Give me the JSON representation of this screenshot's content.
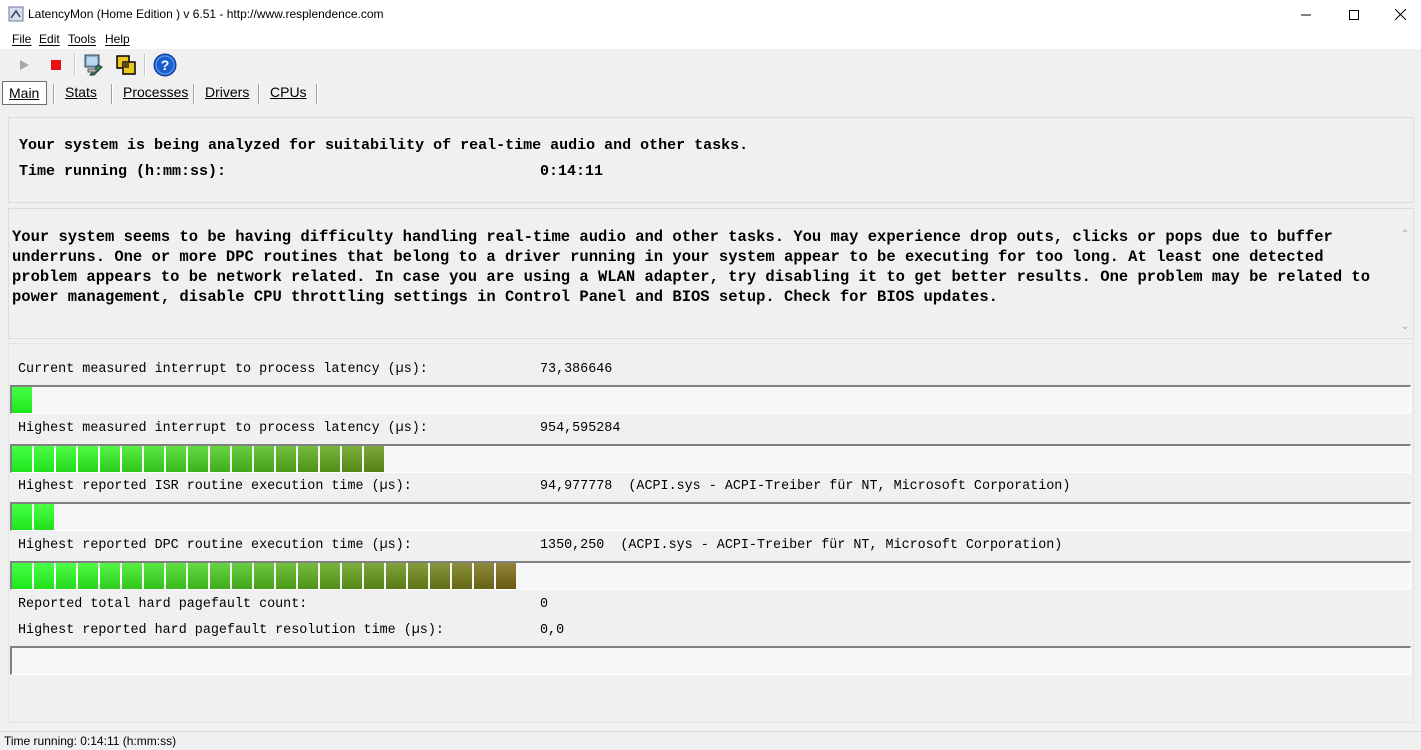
{
  "window": {
    "title": "LatencyMon  (Home Edition )  v 6.51 - http://www.resplendence.com",
    "minimize_glyph": "—",
    "maximize_glyph": "☐",
    "close_glyph": "✕"
  },
  "menu": {
    "items": [
      {
        "label": "File"
      },
      {
        "label": "Edit"
      },
      {
        "label": "Tools"
      },
      {
        "label": "Help"
      }
    ]
  },
  "toolbar": {
    "buttons": [
      {
        "icon": "play-icon",
        "enabled": false
      },
      {
        "icon": "stop-icon",
        "color": "#e81010"
      },
      {
        "icon": "drivers-icon"
      },
      {
        "icon": "windows-icon"
      },
      {
        "icon": "help-icon",
        "label": "?",
        "color": "#1a5fd0"
      }
    ]
  },
  "tabs": [
    {
      "label": "Main",
      "active": true
    },
    {
      "label": "Stats"
    },
    {
      "label": "Processes"
    },
    {
      "label": "Drivers"
    },
    {
      "label": "CPUs"
    }
  ],
  "status": {
    "line1": "Your system is being analyzed for suitability of real-time audio and other tasks.",
    "time_label": "Time running (h:mm:ss):",
    "time_value": "0:14:11"
  },
  "advice": {
    "text": "Your system seems to be having difficulty handling real-time audio and other tasks. You may experience drop outs, clicks or pops due to buffer underruns. One or more DPC routines that belong to a driver running in your system appear to be executing for too long. At least one detected problem appears to be network related. In case you are using a WLAN adapter, try disabling it to get better results. One problem may be related to power management, disable CPU throttling settings in Control Panel and BIOS setup. Check for BIOS updates."
  },
  "metrics": {
    "current_latency": {
      "label": "Current measured interrupt to process latency (µs):",
      "value": "73,386646",
      "bar_segments": 1
    },
    "highest_latency": {
      "label": "Highest measured interrupt to process latency (µs):",
      "value": "954,595284",
      "bar_segments": 17
    },
    "isr": {
      "label": "Highest reported ISR routine execution time (µs):",
      "value": "94,977778  (ACPI.sys - ACPI-Treiber für NT, Microsoft Corporation)",
      "bar_segments": 2
    },
    "dpc": {
      "label": "Highest reported DPC routine execution time (µs):",
      "value": "1350,250  (ACPI.sys - ACPI-Treiber für NT, Microsoft Corporation)",
      "bar_segments": 23
    },
    "pagefault_count": {
      "label": "Reported total hard pagefault count:",
      "value": "0"
    },
    "pagefault_time": {
      "label": "Highest reported hard pagefault resolution time (µs):",
      "value": "0,0",
      "bar_segments": 0
    }
  },
  "colors": {
    "bar_start": "#1ee61e",
    "bar_end": "#6b5a12"
  },
  "statusbar": {
    "text": "Time running: 0:14:11  (h:mm:ss)"
  }
}
